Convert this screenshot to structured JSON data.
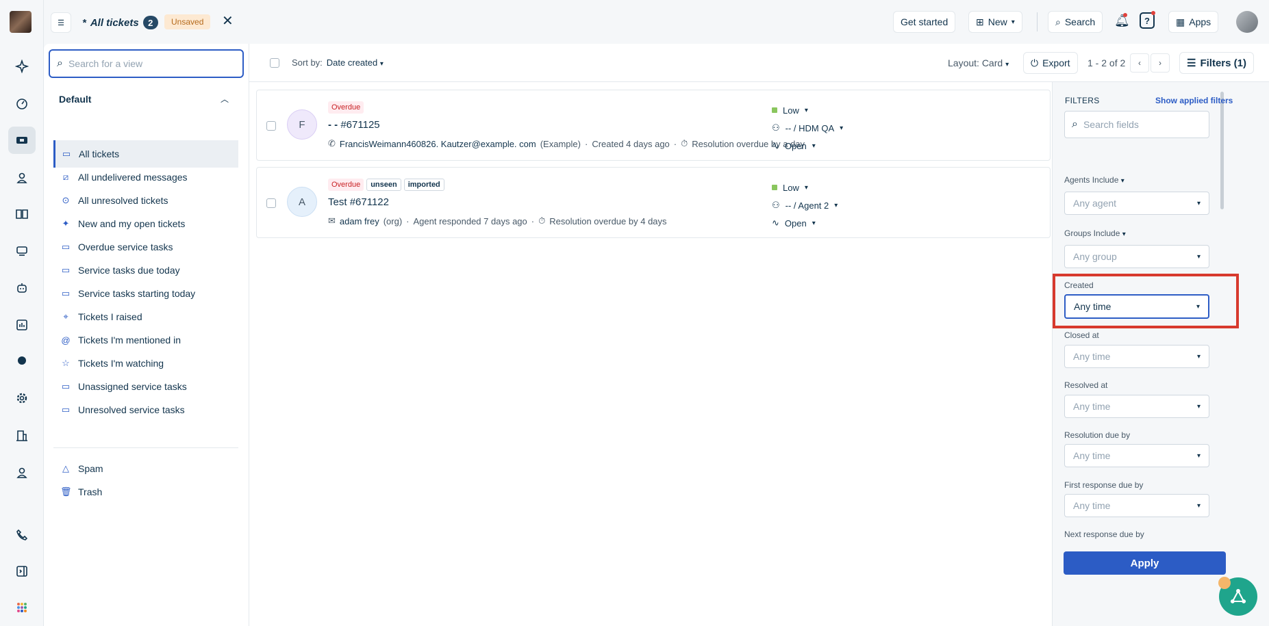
{
  "topbar": {
    "title": "All tickets",
    "count": "2",
    "unsaved": "Unsaved",
    "get_started": "Get started",
    "new": "New",
    "search": "Search",
    "apps": "Apps"
  },
  "views": {
    "search_placeholder": "Search for a view",
    "section": "Default",
    "items": [
      {
        "label": "All tickets",
        "icon": "ticket-icon"
      },
      {
        "label": "All undelivered messages",
        "icon": "undelivered-icon"
      },
      {
        "label": "All unresolved tickets",
        "icon": "unresolved-icon"
      },
      {
        "label": "New and my open tickets",
        "icon": "sparkle-icon"
      },
      {
        "label": "Overdue service tasks",
        "icon": "ticket-icon"
      },
      {
        "label": "Service tasks due today",
        "icon": "ticket-icon"
      },
      {
        "label": "Service tasks starting today",
        "icon": "ticket-icon"
      },
      {
        "label": "Tickets I raised",
        "icon": "megaphone-icon"
      },
      {
        "label": "Tickets I'm mentioned in",
        "icon": "at-icon"
      },
      {
        "label": "Tickets I'm watching",
        "icon": "star-icon"
      },
      {
        "label": "Unassigned service tasks",
        "icon": "ticket-icon"
      },
      {
        "label": "Unresolved service tasks",
        "icon": "ticket-icon"
      }
    ],
    "other": [
      {
        "label": "Spam",
        "icon": "warning-icon"
      },
      {
        "label": "Trash",
        "icon": "trash-icon"
      }
    ]
  },
  "toolbar": {
    "sort_label": "Sort by:",
    "sort_value": "Date created",
    "layout": "Layout: Card",
    "export": "Export",
    "paging": "1 - 2 of 2",
    "filters": "Filters (1)"
  },
  "tickets": [
    {
      "avatar": "F",
      "tags": [
        "Overdue"
      ],
      "title": "- -",
      "number": "#671125",
      "requester": "FrancisWeimann460826. Kautzer@example. com",
      "org": "(Example)",
      "created": "Created 4 days ago",
      "sla": "Resolution overdue by a day",
      "priority": "Low",
      "assignee": "-- / HDM QA",
      "status": "Open"
    },
    {
      "avatar": "A",
      "tags": [
        "Overdue",
        "unseen",
        "imported"
      ],
      "title": "Test",
      "number": "#671122",
      "requester": "adam frey",
      "org": "(org)",
      "created": "Agent responded 7 days ago",
      "sla": "Resolution overdue by 4 days",
      "priority": "Low",
      "assignee": "-- / Agent 2",
      "status": "Open"
    }
  ],
  "filters": {
    "heading": "FILTERS",
    "show_applied": "Show applied filters",
    "search_placeholder": "Search fields",
    "agents_label": "Agents Include",
    "agents_value": "Any agent",
    "groups_label": "Groups Include",
    "groups_value": "Any group",
    "created_label": "Created",
    "created_value": "Any time",
    "closed_label": "Closed at",
    "closed_value": "Any time",
    "resolved_label": "Resolved at",
    "resolved_value": "Any time",
    "resdue_label": "Resolution due by",
    "resdue_value": "Any time",
    "frdue_label": "First response due by",
    "frdue_value": "Any time",
    "nrdue_label": "Next response due by",
    "apply": "Apply"
  },
  "colors": {
    "accent": "#2c5cc5",
    "highlight": "#d73a2e",
    "overdue": "#c82124",
    "priority_low": "#8ac65e"
  }
}
